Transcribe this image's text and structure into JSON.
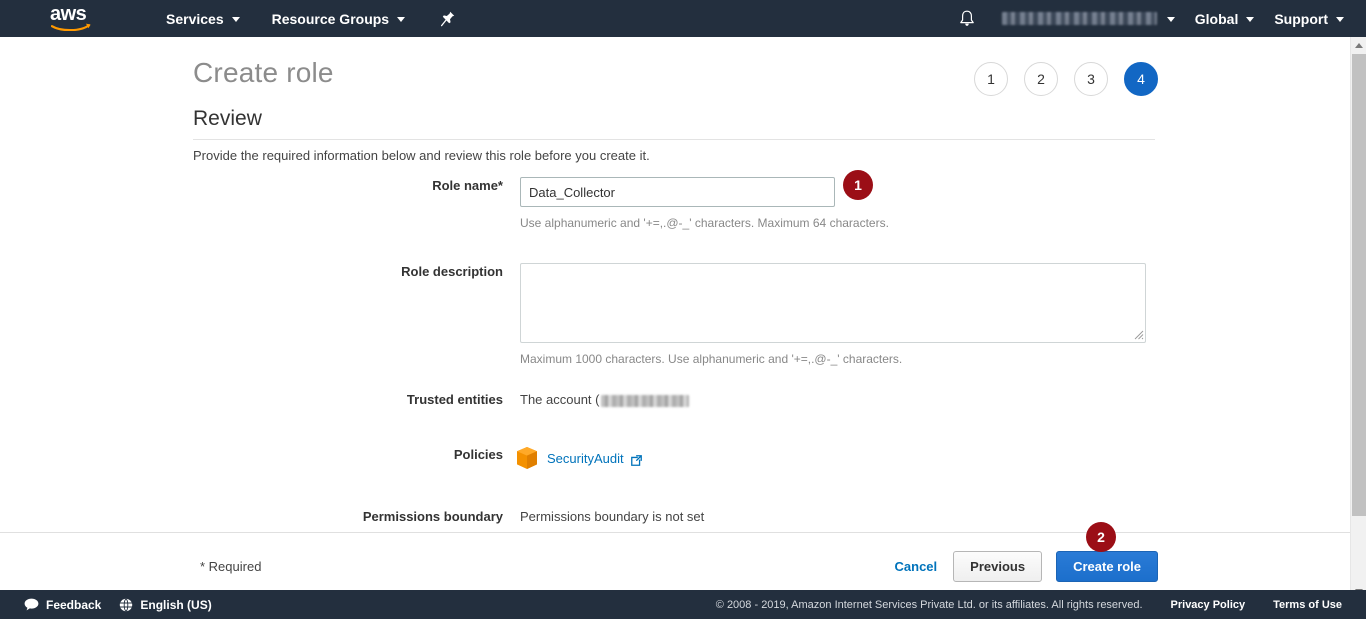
{
  "topnav": {
    "logo_text": "aws",
    "services_label": "Services",
    "resource_groups_label": "Resource Groups",
    "pin_icon": "pin-icon",
    "bell_icon": "bell-icon",
    "account_label": "",
    "region_label": "Global",
    "support_label": "Support"
  },
  "page": {
    "title": "Create role",
    "section_title": "Review",
    "intro": "Provide the required information below and review this role before you create it."
  },
  "steps": {
    "items": [
      "1",
      "2",
      "3",
      "4"
    ],
    "active_index": 3,
    "active_color": "#1267c4"
  },
  "form": {
    "role_name": {
      "label": "Role name*",
      "value": "Data_Collector",
      "placeholder": "",
      "helper": "Use alphanumeric and '+=,.@-_' characters. Maximum 64 characters."
    },
    "role_description": {
      "label": "Role description",
      "value": "",
      "placeholder": "",
      "helper": "Maximum 1000 characters. Use alphanumeric and '+=,.@-_' characters."
    },
    "trusted_entities": {
      "label": "Trusted entities",
      "value": "The account ("
    },
    "policies": {
      "label": "Policies",
      "policy_icon": "policy-cube-icon",
      "policy_name": "SecurityAudit",
      "external_icon": "external-link-icon"
    },
    "permissions_boundary": {
      "label": "Permissions boundary",
      "value": "Permissions boundary is not set"
    }
  },
  "actions": {
    "required_note": "* Required",
    "cancel_label": "Cancel",
    "previous_label": "Previous",
    "create_label": "Create role"
  },
  "annotations": {
    "badge_color": "#9b0e16",
    "items": [
      {
        "id": "1",
        "target": "role-name-input"
      },
      {
        "id": "2",
        "target": "create-role-button"
      }
    ]
  },
  "bottombar": {
    "feedback_label": "Feedback",
    "feedback_icon": "speech-bubble-icon",
    "language_label": "English (US)",
    "language_icon": "globe-icon",
    "copyright": "© 2008 - 2019, Amazon Internet Services Private Ltd. or its affiliates. All rights reserved.",
    "privacy_label": "Privacy Policy",
    "terms_label": "Terms of Use"
  },
  "scrollbar": {
    "up_icon": "scroll-up-arrow-icon",
    "down_icon": "scroll-down-arrow-icon"
  }
}
